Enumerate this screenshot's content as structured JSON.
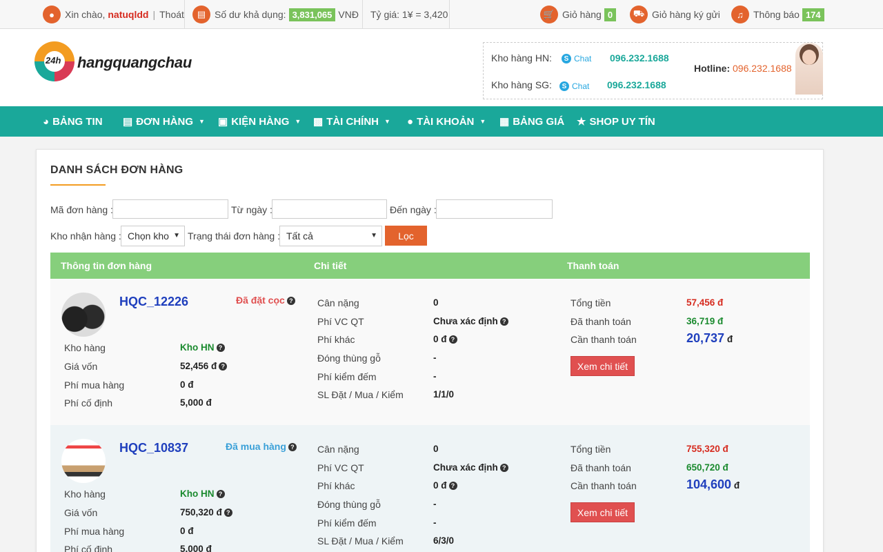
{
  "topbar": {
    "greeting": "Xin chào,",
    "username": "natuqldd",
    "logout": "Thoát",
    "balance_label": "Số dư khả dụng:",
    "balance_value": "3,831,065",
    "balance_currency": "VNĐ",
    "rate": "Tỷ giá: 1¥ = 3,420",
    "cart_label": "Giỏ hàng",
    "cart_count": "0",
    "consign_cart_label": "Giỏ hàng ký gửi",
    "notify_label": "Thông báo",
    "notify_count": "174"
  },
  "header": {
    "logo_badge": "24h",
    "logo_text": "hangquangchau",
    "warehouse_hn_label": "Kho hàng HN:",
    "warehouse_sg_label": "Kho hàng SG:",
    "chat_label": "Chat",
    "phone_hn": "096.232.1688",
    "phone_sg": "096.232.1688",
    "hotline_label": "Hotline:",
    "hotline_value": "096.232.1688"
  },
  "nav": {
    "items": [
      {
        "label": "BẢNG TIN",
        "icon": "dashboard-icon"
      },
      {
        "label": "ĐƠN HÀNG",
        "icon": "file-icon"
      },
      {
        "label": "KIỆN HÀNG",
        "icon": "box-icon"
      },
      {
        "label": "TÀI CHÍNH",
        "icon": "money-icon"
      },
      {
        "label": "TÀI KHOẢN",
        "icon": "user-icon"
      },
      {
        "label": "BẢNG GIÁ",
        "icon": "building-icon"
      },
      {
        "label": "SHOP UY TÍN",
        "icon": "star-icon"
      }
    ]
  },
  "page": {
    "title": "DANH SÁCH ĐƠN HÀNG",
    "filters": {
      "order_code_label": "Mã đơn hàng :",
      "from_date_label": "Từ ngày :",
      "to_date_label": "Đến ngày :",
      "warehouse_label": "Kho nhận hàng :",
      "warehouse_value": "Chọn kho",
      "status_label": "Trạng thái đơn hàng :",
      "status_value": "Tất cả",
      "filter_button": "Lọc"
    },
    "table_headers": [
      "Thông tin đơn hàng",
      "Chi tiết",
      "Thanh toán"
    ]
  },
  "labels": {
    "warehouse": "Kho hàng",
    "cost": "Giá vốn",
    "purchase_fee": "Phí mua hàng",
    "fixed_fee": "Phí cố định",
    "weight": "Cân nặng",
    "intl_shipping": "Phí VC QT",
    "other_fee": "Phí khác",
    "wood_packing": "Đóng thùng gỗ",
    "check_fee": "Phí kiểm đếm",
    "qty": "SL Đặt / Mua / Kiểm",
    "total": "Tổng tiền",
    "paid": "Đã thanh toán",
    "due": "Cần thanh toán",
    "detail_button": "Xem chi tiết"
  },
  "orders": [
    {
      "code": "HQC_12226",
      "status": "Đã đặt cọc",
      "status_color": "#e05050",
      "warehouse": "Kho HN",
      "cost": "52,456 đ",
      "purchase_fee": "0 đ",
      "fixed_fee": "5,000 đ",
      "weight": "0",
      "intl_shipping": "Chưa xác định",
      "other_fee": "0 đ",
      "wood_packing": "-",
      "check_fee": "-",
      "qty": "1/1/0",
      "total": "57,456 đ",
      "paid": "36,719 đ",
      "due": "20,737",
      "due_unit": "đ"
    },
    {
      "code": "HQC_10837",
      "status": "Đã mua hàng",
      "status_color": "#3aa0d8",
      "warehouse": "Kho HN",
      "cost": "750,320 đ",
      "purchase_fee": "0 đ",
      "fixed_fee": "5,000 đ",
      "weight": "0",
      "intl_shipping": "Chưa xác định",
      "other_fee": "0 đ",
      "wood_packing": "-",
      "check_fee": "-",
      "qty": "6/3/0",
      "total": "755,320 đ",
      "paid": "650,720 đ",
      "due": "104,600",
      "due_unit": "đ"
    }
  ]
}
